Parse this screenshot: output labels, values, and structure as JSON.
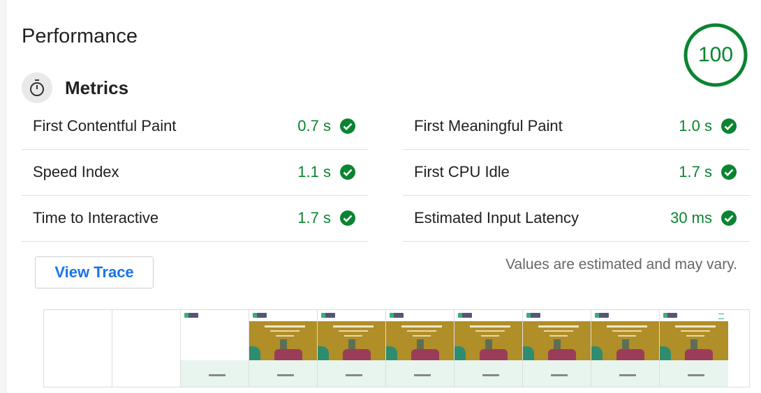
{
  "section": {
    "title": "Performance",
    "score": "100"
  },
  "metrics": {
    "title": "Metrics",
    "icon": "stopwatch-icon",
    "items": [
      {
        "label": "First Contentful Paint",
        "value": "0.7 s"
      },
      {
        "label": "First Meaningful Paint",
        "value": "1.0 s"
      },
      {
        "label": "Speed Index",
        "value": "1.1 s"
      },
      {
        "label": "First CPU Idle",
        "value": "1.7 s"
      },
      {
        "label": "Time to Interactive",
        "value": "1.7 s"
      },
      {
        "label": "Estimated Input Latency",
        "value": "30 ms"
      }
    ]
  },
  "actions": {
    "view_trace": "View Trace"
  },
  "note": "Values are estimated and may vary.",
  "colors": {
    "pass": "#0a8431",
    "link": "#1a73e8"
  },
  "filmstrip": {
    "frames": [
      "blank",
      "blank",
      "header-only",
      "loaded",
      "loaded",
      "loaded",
      "loaded",
      "loaded",
      "loaded",
      "loaded-menu"
    ]
  }
}
